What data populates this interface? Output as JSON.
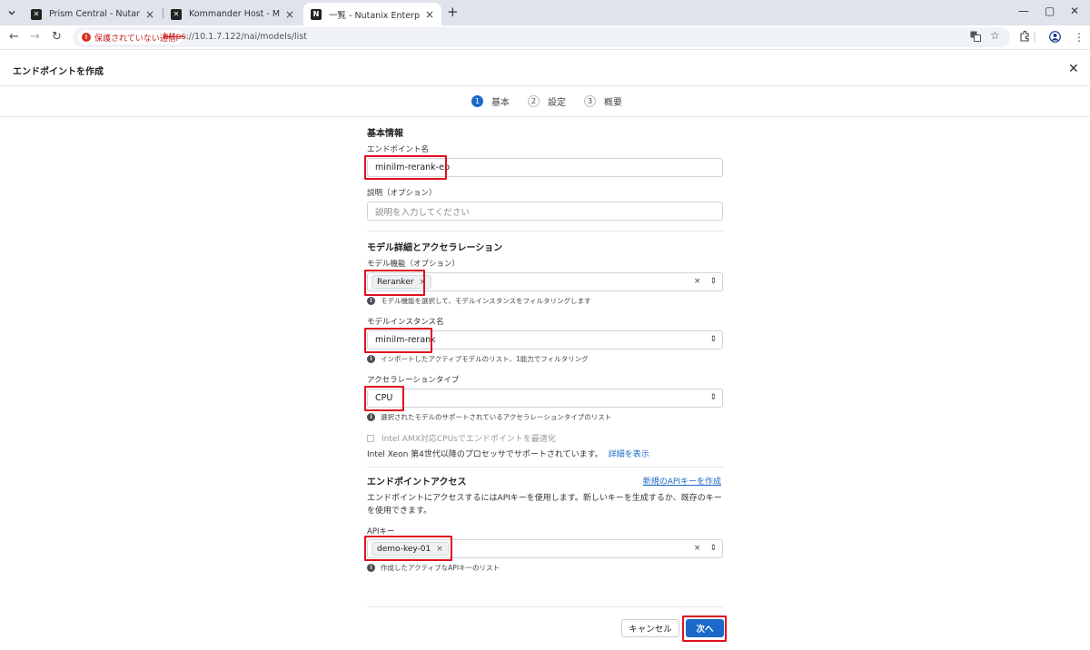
{
  "browser": {
    "tabs": [
      {
        "favicon": "nutanix-x-icon",
        "title": "Prism Central - Nutanix",
        "active": false
      },
      {
        "favicon": "nutanix-x-icon",
        "title": "Kommander Host - Managemen",
        "active": false
      },
      {
        "favicon": "nutanix-n-icon",
        "title": "一覧 - Nutanix Enterprise AI",
        "active": true
      }
    ],
    "security_label": "保護されていない通信",
    "url_scheme": "https",
    "url_rest": "://10.1.7.122/nai/models/list"
  },
  "dialog": {
    "title": "エンドポイントを作成",
    "steps": [
      {
        "num": "1",
        "label": "基本"
      },
      {
        "num": "2",
        "label": "設定"
      },
      {
        "num": "3",
        "label": "概要"
      }
    ],
    "basic": {
      "section_title": "基本情報",
      "name_label": "エンドポイント名",
      "name_value": "minilm-rerank-ep",
      "desc_label": "説明（オプション）",
      "desc_placeholder": "説明を入力してください"
    },
    "model": {
      "section_title": "モデル詳細とアクセラレーション",
      "capability_label": "モデル機能（オプション）",
      "capability_chip": "Reranker",
      "capability_hint": "モデル機能を選択して、モデルインスタンスをフィルタリングします",
      "instance_label": "モデルインスタンス名",
      "instance_value": "minilm-rerank",
      "instance_hint": "インポートしたアクティブモデルのリスト、1能力でフィルタリング",
      "accel_label": "アクセラレーションタイプ",
      "accel_value": "CPU",
      "accel_hint": "選択されたモデルのサポートされているアクセラレーションタイプのリスト",
      "amx_label": "Intel AMX対応CPUsでエンドポイントを最適化",
      "amx_note": "Intel Xeon 第4世代以降のプロセッサでサポートされています。",
      "amx_link": "詳細を表示"
    },
    "access": {
      "section_title": "エンドポイントアクセス",
      "new_key_link": "新規のAPIキーを作成",
      "description": "エンドポイントにアクセスするにはAPIキーを使用します。新しいキーを生成するか、既存のキーを使用できます。",
      "key_label": "APIキー",
      "key_chip": "demo-key-01",
      "key_hint": "作成したアクティブなAPIキーのリスト"
    },
    "buttons": {
      "cancel": "キャンセル",
      "next": "次へ"
    }
  },
  "colors": {
    "accent": "#1b6ac9",
    "highlight": "#e0101e"
  }
}
